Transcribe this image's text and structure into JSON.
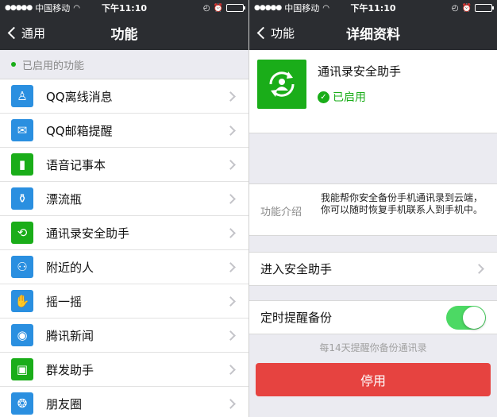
{
  "status_bar": {
    "signal_dots": "●●●●●",
    "carrier": "中国移动",
    "time": "下午11:10"
  },
  "left": {
    "nav": {
      "back_label": "通用",
      "title": "功能"
    },
    "section_header": "已启用的功能",
    "features": [
      {
        "label": "QQ离线消息",
        "icon": "qq-penguin-icon",
        "color": "#2a8fe0",
        "glyph": "♙"
      },
      {
        "label": "QQ邮箱提醒",
        "icon": "mail-envelope-icon",
        "color": "#2a8fe0",
        "glyph": "✉"
      },
      {
        "label": "语音记事本",
        "icon": "voice-notepad-icon",
        "color": "#1aad19",
        "glyph": "▮"
      },
      {
        "label": "漂流瓶",
        "icon": "drift-bottle-icon",
        "color": "#2a8fe0",
        "glyph": "⚱"
      },
      {
        "label": "通讯录安全助手",
        "icon": "contacts-sync-icon",
        "color": "#1aad19",
        "glyph": "⟲"
      },
      {
        "label": "附近的人",
        "icon": "people-nearby-icon",
        "color": "#2a8fe0",
        "glyph": "⚇"
      },
      {
        "label": "摇一摇",
        "icon": "shake-hand-icon",
        "color": "#2a8fe0",
        "glyph": "✋"
      },
      {
        "label": "腾讯新闻",
        "icon": "tencent-news-icon",
        "color": "#2a8fe0",
        "glyph": "◉"
      },
      {
        "label": "群发助手",
        "icon": "mass-message-icon",
        "color": "#1aad19",
        "glyph": "▣"
      },
      {
        "label": "朋友圈",
        "icon": "moments-aperture-icon",
        "color": "#2a8fe0",
        "glyph": "❂"
      }
    ]
  },
  "right": {
    "nav": {
      "back_label": "功能",
      "title": "详细资料"
    },
    "app": {
      "name": "通讯录安全助手",
      "status": "已启用"
    },
    "intro": {
      "label": "功能介绍",
      "text": "我能帮你安全备份手机通讯录到云端，你可以随时恢复手机联系人到手机中。"
    },
    "enter_label": "进入安全助手",
    "reminder": {
      "label": "定时提醒备份",
      "enabled": true,
      "hint": "每14天提醒你备份通讯录"
    },
    "disable_button": "停用"
  },
  "colors": {
    "accent_green": "#1aad19",
    "danger_red": "#e64340",
    "switch_on": "#4cd964",
    "navbar": "#2b2d31"
  }
}
